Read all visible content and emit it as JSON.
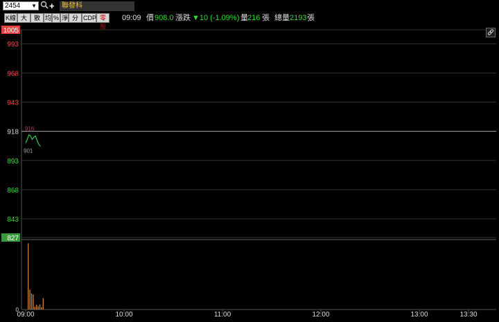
{
  "toolbar": {
    "code_value": "2454",
    "stock_name": "聯發科",
    "tabs": [
      {
        "label": "K線"
      },
      {
        "label": "大戶"
      },
      {
        "label": "散戶"
      },
      {
        "label": "均"
      },
      {
        "label": "%"
      },
      {
        "label": "淨"
      },
      {
        "label": "分價"
      },
      {
        "label": "CDP"
      },
      {
        "label": "零股"
      }
    ]
  },
  "quote": {
    "time": "09:09",
    "price_label": "價",
    "price_value": "908.0",
    "change_label": "漲跌",
    "change_value": "▼10 (-1.09%)",
    "volume_label": "量",
    "volume_value": "216",
    "volume_unit": "張",
    "total_label": "總量",
    "total_value": "2193",
    "total_unit": "張"
  },
  "colors": {
    "up": "#ff4444",
    "down": "#33dd33",
    "volume": "#c87832",
    "line": "#33cc55",
    "high_label": "#cc3366"
  },
  "icons": [
    "chevron-down-icon",
    "search-icon",
    "plus-icon",
    "link-icon"
  ],
  "chart_data": {
    "type": "line",
    "title": "",
    "reference_price": 918,
    "y_labels": [
      "1005",
      "993",
      "968",
      "943",
      "918",
      "893",
      "868",
      "843",
      "827"
    ],
    "y_ticks": [
      1005,
      993,
      968,
      943,
      918,
      893,
      868,
      843,
      827
    ],
    "ylim": [
      827,
      1005
    ],
    "x_labels": [
      "09:00",
      "10:00",
      "11:00",
      "12:00",
      "13:00",
      "13:30"
    ],
    "high_label": "916",
    "low_label": "901",
    "series": [
      {
        "x": [
          "09:00",
          "09:01",
          "09:02",
          "09:03",
          "09:04",
          "09:05",
          "09:06",
          "09:07",
          "09:08",
          "09:09"
        ],
        "values": [
          908,
          911,
          915,
          914,
          911,
          913,
          914,
          910,
          907,
          905
        ]
      }
    ],
    "volume": {
      "zero_label": "0",
      "x": [
        "09:00",
        "09:01",
        "09:02",
        "09:03",
        "09:04",
        "09:05",
        "09:06",
        "09:07",
        "09:08",
        "09:09"
      ],
      "values": [
        1400,
        420,
        340,
        320,
        60,
        100,
        70,
        110,
        50,
        240
      ],
      "ylim": [
        0,
        1450
      ]
    }
  }
}
